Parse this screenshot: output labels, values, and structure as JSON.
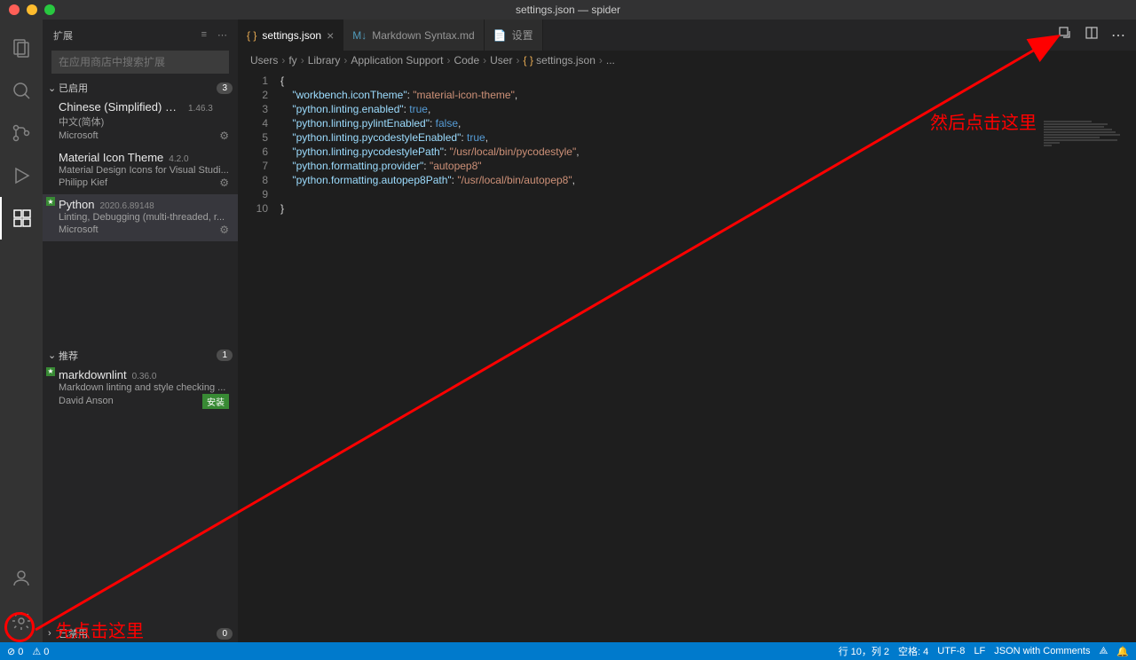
{
  "window": {
    "title": "settings.json — spider"
  },
  "sidebar": {
    "title": "扩展",
    "search_placeholder": "在应用商店中搜索扩展",
    "sections": {
      "enabled": {
        "label": "已启用",
        "count": "3"
      },
      "recommended": {
        "label": "推荐",
        "count": "1"
      },
      "disabled": {
        "label": "已禁用",
        "count": "0"
      }
    },
    "installed": [
      {
        "name": "Chinese (Simplified) Langua...",
        "version": "1.46.3",
        "desc": "中文(简体)",
        "publisher": "Microsoft"
      },
      {
        "name": "Material Icon Theme",
        "version": "4.2.0",
        "desc": "Material Design Icons for Visual Studi...",
        "publisher": "Philipp Kief"
      },
      {
        "name": "Python",
        "version": "2020.6.89148",
        "desc": "Linting, Debugging (multi-threaded, r...",
        "publisher": "Microsoft"
      }
    ],
    "recommended_items": [
      {
        "name": "markdownlint",
        "version": "0.36.0",
        "desc": "Markdown linting and style checking ...",
        "publisher": "David Anson",
        "install": "安装"
      }
    ]
  },
  "tabs": [
    {
      "icon": "{ }",
      "label": "settings.json",
      "active": true,
      "closable": true
    },
    {
      "icon": "M↓",
      "label": "Markdown Syntax.md",
      "active": false
    },
    {
      "icon": "📄",
      "label": "设置",
      "active": false
    }
  ],
  "breadcrumb": [
    "Users",
    "fy",
    "Library",
    "Application Support",
    "Code",
    "User",
    "settings.json",
    "..."
  ],
  "code_lines": [
    {
      "n": "1",
      "tokens": [
        {
          "t": "{",
          "c": "brace"
        }
      ]
    },
    {
      "n": "2",
      "tokens": [
        {
          "t": "    ",
          "c": ""
        },
        {
          "t": "\"workbench.iconTheme\"",
          "c": "key"
        },
        {
          "t": ": ",
          "c": "punc"
        },
        {
          "t": "\"material-icon-theme\"",
          "c": "str"
        },
        {
          "t": ",",
          "c": "punc"
        }
      ]
    },
    {
      "n": "3",
      "tokens": [
        {
          "t": "    ",
          "c": ""
        },
        {
          "t": "\"python.linting.enabled\"",
          "c": "key"
        },
        {
          "t": ": ",
          "c": "punc"
        },
        {
          "t": "true",
          "c": "bool"
        },
        {
          "t": ",",
          "c": "punc"
        }
      ]
    },
    {
      "n": "4",
      "tokens": [
        {
          "t": "    ",
          "c": ""
        },
        {
          "t": "\"python.linting.pylintEnabled\"",
          "c": "key"
        },
        {
          "t": ": ",
          "c": "punc"
        },
        {
          "t": "false",
          "c": "bool"
        },
        {
          "t": ",",
          "c": "punc"
        }
      ]
    },
    {
      "n": "5",
      "tokens": [
        {
          "t": "    ",
          "c": ""
        },
        {
          "t": "\"python.linting.pycodestyleEnabled\"",
          "c": "key"
        },
        {
          "t": ": ",
          "c": "punc"
        },
        {
          "t": "true",
          "c": "bool"
        },
        {
          "t": ",",
          "c": "punc"
        }
      ]
    },
    {
      "n": "6",
      "tokens": [
        {
          "t": "    ",
          "c": ""
        },
        {
          "t": "\"python.linting.pycodestylePath\"",
          "c": "key"
        },
        {
          "t": ": ",
          "c": "punc"
        },
        {
          "t": "\"/usr/local/bin/pycodestyle\"",
          "c": "str"
        },
        {
          "t": ",",
          "c": "punc"
        }
      ]
    },
    {
      "n": "7",
      "tokens": [
        {
          "t": "    ",
          "c": ""
        },
        {
          "t": "\"python.formatting.provider\"",
          "c": "key"
        },
        {
          "t": ": ",
          "c": "punc"
        },
        {
          "t": "\"autopep8\"",
          "c": "str"
        }
      ]
    },
    {
      "n": "8",
      "tokens": [
        {
          "t": "    ",
          "c": ""
        },
        {
          "t": "\"python.formatting.autopep8Path\"",
          "c": "key"
        },
        {
          "t": ": ",
          "c": "punc"
        },
        {
          "t": "\"/usr/local/bin/autopep8\"",
          "c": "str"
        },
        {
          "t": ",",
          "c": "punc"
        }
      ]
    },
    {
      "n": "9",
      "tokens": []
    },
    {
      "n": "10",
      "tokens": [
        {
          "t": "}",
          "c": "brace"
        }
      ]
    }
  ],
  "statusbar": {
    "left": [
      "⊘ 0",
      "⚠ 0"
    ],
    "right": [
      "行 10，列 2",
      "空格: 4",
      "UTF-8",
      "LF",
      "JSON with Comments",
      "⟁",
      "🔔"
    ]
  },
  "annotations": {
    "text1": "先点击这里",
    "text2": "然后点击这里"
  }
}
